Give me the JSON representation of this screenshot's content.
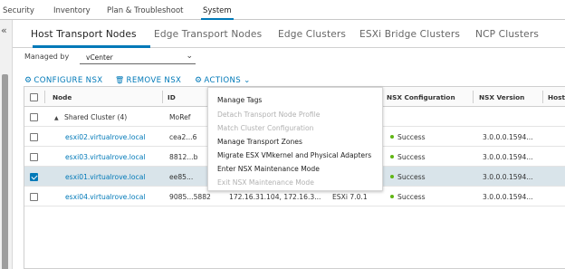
{
  "topnav": {
    "items": [
      {
        "label": "Security"
      },
      {
        "label": "Inventory"
      },
      {
        "label": "Plan & Troubleshoot"
      },
      {
        "label": "System"
      }
    ],
    "active_index": 3
  },
  "rail": {
    "collapse_glyph": "«"
  },
  "tabs": [
    {
      "label": "Host Transport Nodes",
      "active": true
    },
    {
      "label": "Edge Transport Nodes"
    },
    {
      "label": "Edge Clusters"
    },
    {
      "label": "ESXi Bridge Clusters"
    },
    {
      "label": "NCP Clusters"
    }
  ],
  "filter": {
    "label": "Managed by",
    "value": "vCenter",
    "caret": "⌄"
  },
  "actions": {
    "configure": {
      "label": "CONFIGURE NSX",
      "icon": "gear-icon",
      "glyph": "⚙"
    },
    "remove": {
      "label": "REMOVE NSX",
      "icon": "trash-icon",
      "glyph": "🗑"
    },
    "more": {
      "label": "ACTIONS ⌄",
      "icon": "gear-icon",
      "glyph": "⚙"
    }
  },
  "table": {
    "columns": [
      "Node",
      "ID",
      "NSX Configuration",
      "NSX Version",
      "Host"
    ],
    "rows": [
      {
        "node": "Shared Cluster (4)",
        "id": "MoRef",
        "type": "group",
        "expand_glyph": "▲"
      },
      {
        "node": "esxi02.virtualrove.local",
        "id": "cea2...6",
        "status": "Success",
        "version": "3.0.0.0.1594...",
        "selected": false
      },
      {
        "node": "esxi03.virtualrove.local",
        "id": "8812...b",
        "status": "Success",
        "version": "3.0.0.0.1594...",
        "selected": false
      },
      {
        "node": "esxi01.virtualrove.local",
        "id": "ee85...",
        "status": "Success",
        "version": "3.0.0.0.1594...",
        "selected": true
      },
      {
        "node": "esxi04.virtualrove.local",
        "id": "9085...5882",
        "ip": "172.16.31.104, 172.16.3...",
        "os": "ESXi 7.0.1",
        "status": "Success",
        "version": "3.0.0.0.1594...",
        "selected": false
      }
    ]
  },
  "menu": {
    "items": [
      {
        "label": "Manage Tags",
        "disabled": false
      },
      {
        "label": "Detach Transport Node Profile",
        "disabled": true
      },
      {
        "label": "Match Cluster Configuration",
        "disabled": true
      },
      {
        "label": "Manage Transport Zones",
        "disabled": false
      },
      {
        "label": "Migrate ESX VMkernel and Physical Adapters",
        "disabled": false
      },
      {
        "label": "Enter NSX Maintenance Mode",
        "disabled": false
      },
      {
        "label": "Exit NSX Maintenance Mode",
        "disabled": true
      }
    ]
  },
  "colors": {
    "accent": "#0079b8",
    "success": "#60b515",
    "selected_row": "#d9e4ea"
  }
}
